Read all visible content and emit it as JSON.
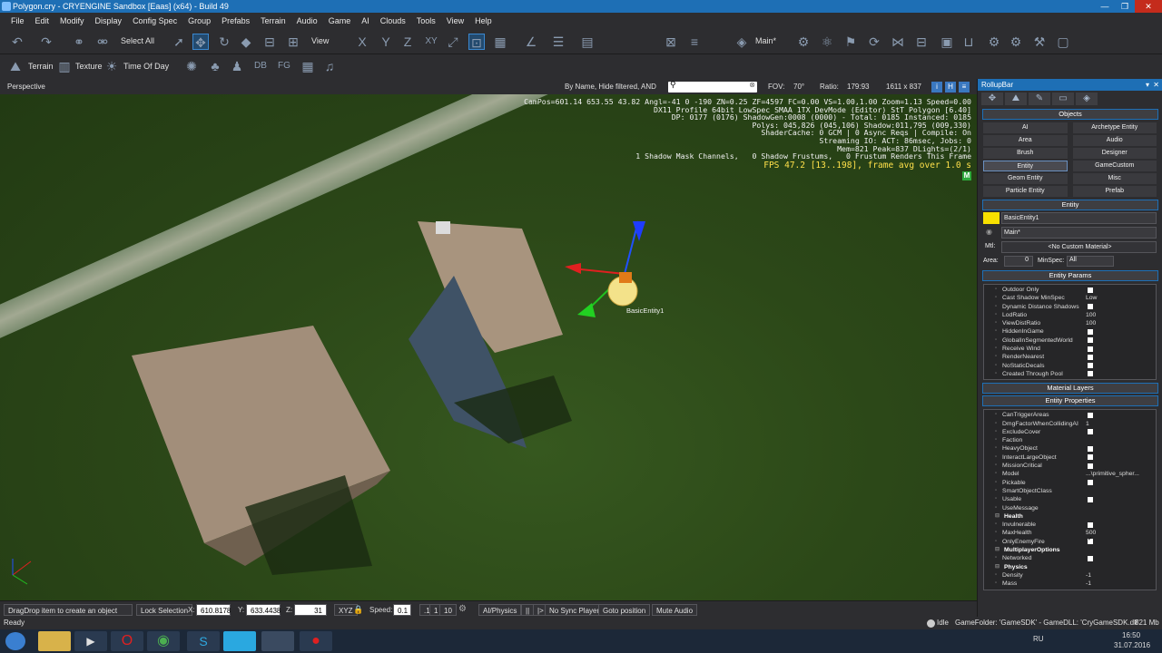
{
  "title": "Polygon.cry - CRYENGINE Sandbox [Eaas] (x64) - Build 49",
  "menu": [
    "File",
    "Edit",
    "Modify",
    "Display",
    "Config Spec",
    "Group",
    "Prefabs",
    "Terrain",
    "Audio",
    "Game",
    "AI",
    "Clouds",
    "Tools",
    "View",
    "Help"
  ],
  "toolbar": {
    "select_all": "Select All",
    "view": "View",
    "main_layer": "Main*",
    "terrain": "Terrain",
    "texture": "Texture",
    "time_of_day": "Time Of Day"
  },
  "viewport": {
    "name": "Perspective",
    "filter_text": "By Name, Hide filtered, AND",
    "fov_label": "FOV:",
    "fov": "70°",
    "ratio_label": "Ratio:",
    "ratio": "179:93",
    "resolution": "1611 x 837",
    "debug_lines": [
      "CamPos=601.14 653.55 43.82 Angl=-41 0 -190 ZN=0.25 ZF=4597 FC=0.00 VS=1.00,1.00 Zoom=1.13 Speed=0.00",
      "DX11 Profile 64bit LowSpec SMAA 1TX DevMode (Editor) StT Polygon [6.40]",
      "DP: 0177 (0176) ShadowGen:0008 (0000) - Total: 0185 Instanced: 0185",
      "Polys: 045,826 (045,106) Shadow:011,795 (009,330)",
      "ShaderCache: 0 GCM | 0 Async Reqs | Compile: On",
      "Streaming IO: ACT: 86msec, Jobs: 0",
      "Mem=821 Peak=837 DLights=(2/1)",
      "1 Shadow Mask Channels,   0 Shadow Frustums,   0 Frustum Renders This Frame"
    ],
    "fps_line": "FPS 47.2 [13..198], frame avg over 1.0 s",
    "m_badge": "M",
    "entity_label": "BasicEntity1"
  },
  "statusbar": {
    "hint": "DragDrop item to create an object",
    "lock_selection": "Lock Selection",
    "x_label": "X:",
    "x": "610.8178",
    "y_label": "Y:",
    "y": "633.4438",
    "z_label": "Z:",
    "z": "31",
    "xyz": "XYZ",
    "speed_label": "Speed:",
    "speed": "0.1",
    "speed_1": ".1",
    "speed_2": "1",
    "speed_3": "10",
    "ai_physics": "AI/Physics",
    "no_sync": "No Sync Player",
    "goto": "Goto position",
    "mute": "Mute Audio",
    "ready": "Ready",
    "idle": "Idle",
    "game_folder": "GameFolder: 'GameSDK' - GameDLL: 'CryGameSDK.dll'",
    "mem": "821 Mb"
  },
  "taskbar": {
    "lang": "RU",
    "time": "16:50",
    "date": "31.07.2016"
  },
  "rollup": {
    "title": "RollupBar",
    "objects_header": "Objects",
    "objects": [
      "AI",
      "Archetype Entity",
      "Area",
      "Audio",
      "Brush",
      "Designer",
      "Entity",
      "GameCustom",
      "Geom Entity",
      "Misc",
      "Particle Entity",
      "Prefab"
    ],
    "entity_header": "Entity",
    "entity_name": "BasicEntity1",
    "layer": "Main*",
    "mtl_label": "Mtl:",
    "mtl": "<No Custom Material>",
    "area_label": "Area:",
    "area": "0",
    "minspec_label": "MinSpec:",
    "minspec": "All",
    "params_header": "Entity Params",
    "params": [
      {
        "name": "Outdoor Only",
        "type": "cb",
        "on": false
      },
      {
        "name": "Cast Shadow MinSpec",
        "type": "val",
        "value": "Low"
      },
      {
        "name": "Dynamic Distance Shadows",
        "type": "cb",
        "on": false
      },
      {
        "name": "LodRatio",
        "type": "val",
        "value": "100"
      },
      {
        "name": "ViewDistRatio",
        "type": "val",
        "value": "100"
      },
      {
        "name": "HiddenInGame",
        "type": "cb",
        "on": false
      },
      {
        "name": "GlobalInSegmentedWorld",
        "type": "cb",
        "on": false
      },
      {
        "name": "Receive Wind",
        "type": "cb",
        "on": false
      },
      {
        "name": "RenderNearest",
        "type": "cb",
        "on": false
      },
      {
        "name": "NoStaticDecals",
        "type": "cb",
        "on": false
      },
      {
        "name": "Created Through Pool",
        "type": "cb",
        "on": false
      }
    ],
    "material_layers_header": "Material Layers",
    "props_header": "Entity Properties",
    "props": [
      {
        "name": "CanTriggerAreas",
        "type": "cb",
        "on": false
      },
      {
        "name": "DmgFactorWhenCollidingAI",
        "type": "val",
        "value": "1"
      },
      {
        "name": "ExcludeCover",
        "type": "cb",
        "on": false
      },
      {
        "name": "Faction",
        "type": "val",
        "value": ""
      },
      {
        "name": "HeavyObject",
        "type": "cb",
        "on": false
      },
      {
        "name": "InteractLargeObject",
        "type": "cb",
        "on": false
      },
      {
        "name": "MissionCritical",
        "type": "cb",
        "on": false
      },
      {
        "name": "Model",
        "type": "val",
        "value": "...\\primitive_spher..."
      },
      {
        "name": "Pickable",
        "type": "cb",
        "on": false
      },
      {
        "name": "SmartObjectClass",
        "type": "val",
        "value": ""
      },
      {
        "name": "Usable",
        "type": "cb",
        "on": false
      },
      {
        "name": "UseMessage",
        "type": "val",
        "value": ""
      },
      {
        "name": "Health",
        "type": "grp"
      },
      {
        "name": "Invulnerable",
        "type": "cb",
        "on": false
      },
      {
        "name": "MaxHealth",
        "type": "val",
        "value": "500"
      },
      {
        "name": "OnlyEnemyFire",
        "type": "cb",
        "on": true
      },
      {
        "name": "MultiplayerOptions",
        "type": "grp"
      },
      {
        "name": "Networked",
        "type": "cb",
        "on": false
      },
      {
        "name": "Physics",
        "type": "grp"
      },
      {
        "name": "Density",
        "type": "val",
        "value": "-1"
      },
      {
        "name": "Mass",
        "type": "val",
        "value": "-1"
      }
    ]
  }
}
